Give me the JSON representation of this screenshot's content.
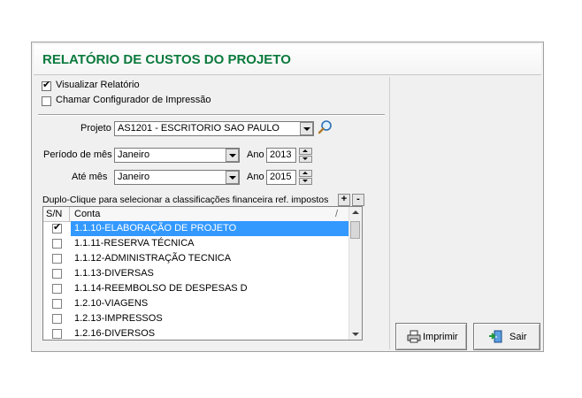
{
  "title": "RELATÓRIO DE CUSTOS DO PROJETO",
  "options": {
    "visualizar": {
      "label": "Visualizar Relatório",
      "checked": true
    },
    "configurador": {
      "label": "Chamar Configurador de Impressão",
      "checked": false
    }
  },
  "projeto": {
    "label": "Projeto",
    "value": "AS1201 - ESCRITORIO SAO PAULO"
  },
  "periodo": {
    "label": "Período de mês",
    "month": "Janeiro",
    "ano_label": "Ano",
    "year": "2013"
  },
  "ate": {
    "label": "Até mês",
    "month": "Janeiro",
    "ano_label": "Ano",
    "year": "2015"
  },
  "instructions": "Duplo-Clique para selecionar a classificações financeira ref. impostos",
  "expand_label": "+",
  "collapse_label": "-",
  "grid": {
    "col_sn": "S/N",
    "col_conta": "Conta",
    "sort_indicator": "/",
    "rows": [
      {
        "conta": "1.1.10-ELABORAÇÃO DE PROJETO",
        "checked": true,
        "selected": true
      },
      {
        "conta": "1.1.11-RESERVA TÉCNICA",
        "checked": false,
        "selected": false
      },
      {
        "conta": "1.1.12-ADMINISTRAÇÃO TECNICA",
        "checked": false,
        "selected": false
      },
      {
        "conta": "1.1.13-DIVERSAS",
        "checked": false,
        "selected": false
      },
      {
        "conta": "1.1.14-REEMBOLSO DE DESPESAS D",
        "checked": false,
        "selected": false
      },
      {
        "conta": "1.2.10-VIAGENS",
        "checked": false,
        "selected": false
      },
      {
        "conta": "1.2.13-IMPRESSOS",
        "checked": false,
        "selected": false
      },
      {
        "conta": "1.2.16-DIVERSOS",
        "checked": false,
        "selected": false
      }
    ]
  },
  "buttons": {
    "imprimir": "Imprimir",
    "sair": "Sair"
  },
  "colors": {
    "title": "#0b7a3d",
    "selection": "#3399ff"
  },
  "icons": {
    "print": "printer-icon",
    "exit": "exit-door-icon",
    "search": "magnifier-icon"
  }
}
